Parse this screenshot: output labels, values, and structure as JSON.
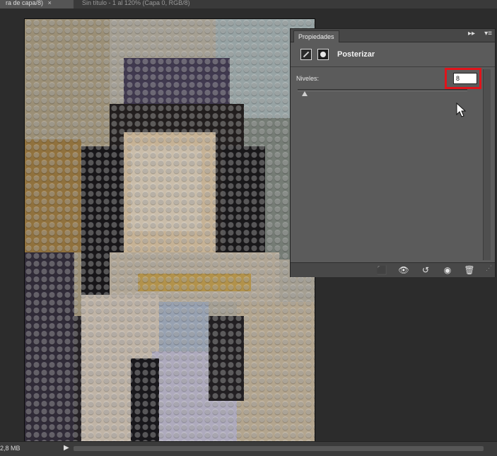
{
  "document_tabs": [
    {
      "label": "ra de capa/8)",
      "active": true,
      "close_icon": "×"
    },
    {
      "label": "Sin título - 1 al 120% (Capa 0, RGB/8)",
      "active": false
    }
  ],
  "status_bar": {
    "doc_size": "2,8 MB",
    "arrow_icon": "triangle-right-icon"
  },
  "properties_panel": {
    "tab_label": "Propiedades",
    "collapse_icon": "double-chevron-right-icon",
    "menu_icon": "panel-menu-icon",
    "adjustment_icon": "posterize-icon",
    "mask_icon": "layer-mask-icon",
    "adjustment_name": "Posterizar",
    "levels_label": "Niveles:",
    "levels_value": "8",
    "slider_level_fraction": 0.02,
    "highlight_color": "#e0141b",
    "footer_icons": [
      "clip-to-layer-icon",
      "view-previous-state-icon",
      "reset-icon",
      "visibility-icon",
      "trash-icon"
    ]
  }
}
